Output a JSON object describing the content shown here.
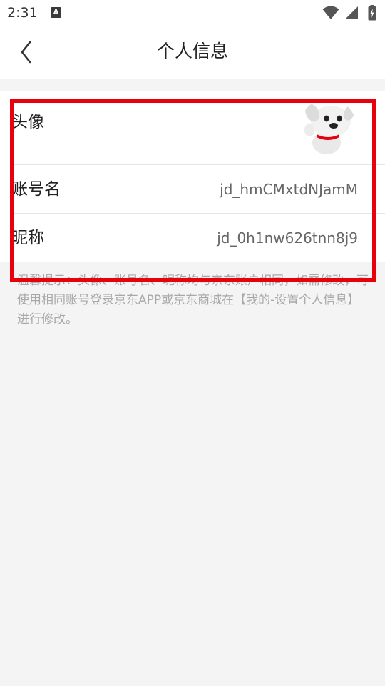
{
  "status_bar": {
    "time": "2:31",
    "notification_icon": "A",
    "icons": [
      "wifi-icon",
      "cellular-signal-icon",
      "battery-charging-icon"
    ]
  },
  "header": {
    "back_icon": "chevron-left-icon",
    "title": "个人信息"
  },
  "profile": {
    "avatar_label": "头像",
    "avatar_image": "jd-joy-dog-mascot",
    "account_label": "账号名",
    "account_value": "jd_hmCMxtdNJamM",
    "nickname_label": "昵称",
    "nickname_value": "jd_0h1nw626tnn8j9"
  },
  "tip": {
    "text": "温馨提示：头像、账号名、昵称均与京东账户相同，如需修改，可使用相同账号登录京东APP或京东商城在【我的-设置个人信息】进行修改。"
  },
  "colors": {
    "highlight": "#e8000d",
    "background": "#f4f4f4",
    "card": "#ffffff",
    "value_text": "#666666",
    "tip_text": "#a8a8a8"
  }
}
